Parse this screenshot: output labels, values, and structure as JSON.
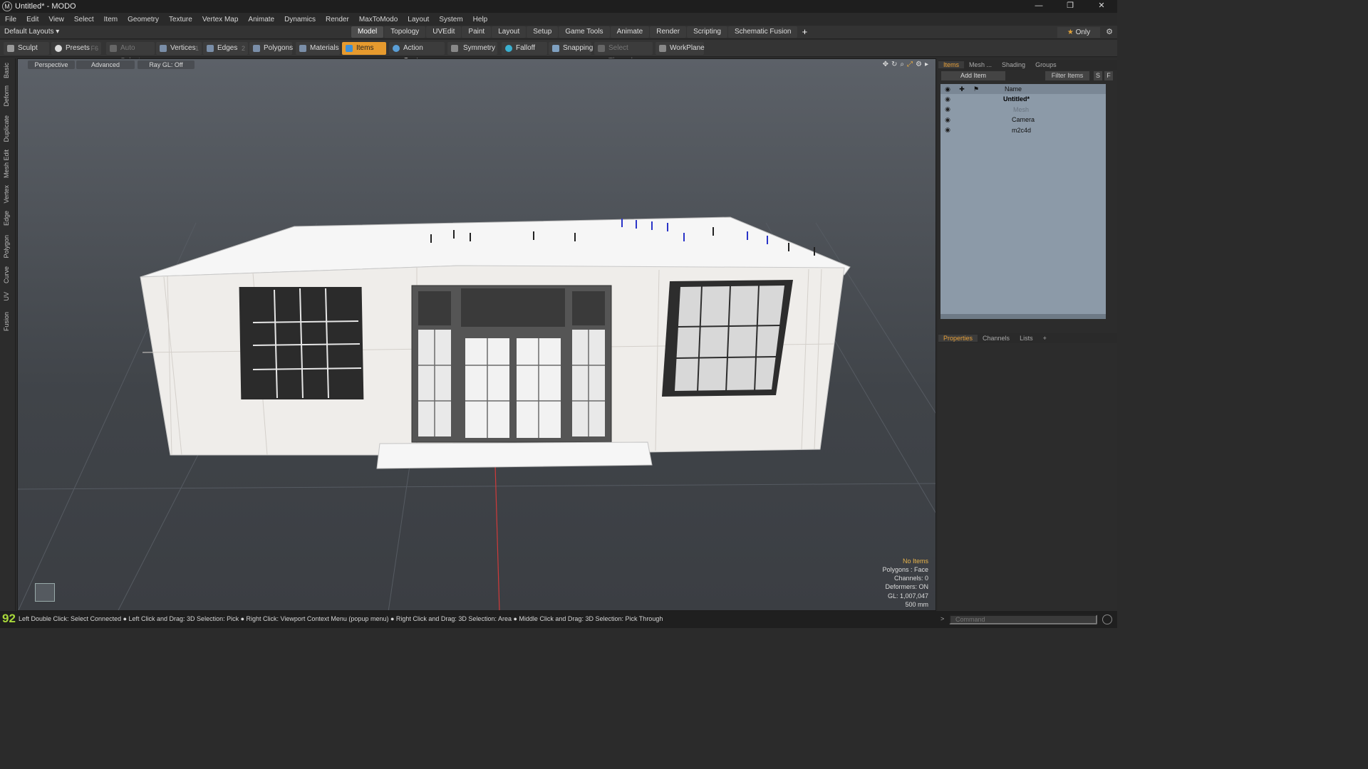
{
  "window": {
    "title": "Untitled* - MODO",
    "logo": "M",
    "controls": [
      "—",
      "❐",
      "✕"
    ]
  },
  "menu": [
    "File",
    "Edit",
    "View",
    "Select",
    "Item",
    "Geometry",
    "Texture",
    "Vertex Map",
    "Animate",
    "Dynamics",
    "Render",
    "MaxToModo",
    "Layout",
    "System",
    "Help"
  ],
  "layout": {
    "default_layouts": "Default Layouts ▾",
    "tabs": [
      "Model",
      "Topology",
      "UVEdit",
      "Paint",
      "Layout",
      "Setup",
      "Game Tools",
      "Animate",
      "Render",
      "Scripting",
      "Schematic Fusion"
    ],
    "active_tab": "Model",
    "add": "+",
    "only": "Only",
    "star": "★"
  },
  "toolbar": {
    "sculpt": "Sculpt",
    "presets": "Presets",
    "presets_key": "F6",
    "auto_select": "Auto Select",
    "vertices": "Vertices",
    "vertices_key": "1",
    "edges": "Edges",
    "edges_key": "2",
    "polygons": "Polygons",
    "materials": "Materials",
    "items": "Items",
    "action_center": "Action Center",
    "symmetry": "Symmetry",
    "falloff": "Falloff",
    "snapping": "Snapping",
    "select_through": "Select Through",
    "workplane": "WorkPlane"
  },
  "left_tabs": [
    "Basic",
    "Deform",
    "Duplicate",
    "Mesh Edit",
    "Vertex",
    "Edge",
    "Polygon",
    "Curve",
    "UV",
    "Fusion"
  ],
  "viewport": {
    "perspective": "Perspective",
    "advanced": "Advanced",
    "raygl": "Ray GL: Off",
    "icons": [
      "✥",
      "↻",
      "⌕",
      "⤢",
      "⚙",
      "▸"
    ],
    "stats": {
      "items": "No Items",
      "polygons": "Polygons : Face",
      "channels": "Channels: 0",
      "deformers": "Deformers: ON",
      "gl": "GL: 1,007,047",
      "scale": "500 mm"
    }
  },
  "items_panel": {
    "tabs": [
      "Items",
      "Mesh ...",
      "Shading",
      "Groups"
    ],
    "add_item": "Add Item",
    "filter": "Filter Items",
    "s": "S",
    "f": "F",
    "name_header": "Name",
    "rows": [
      {
        "name": "Untitled*"
      },
      {
        "name": "Mesh"
      },
      {
        "name": "Camera"
      },
      {
        "name": "m2c4d"
      }
    ]
  },
  "props_panel": {
    "tabs": [
      "Properties",
      "Channels",
      "Lists",
      "+"
    ]
  },
  "status": {
    "num": "92",
    "message": "Left Double Click: Select Connected ● Left Click and Drag: 3D Selection: Pick ● Right Click: Viewport Context Menu (popup menu) ● Right Click and Drag: 3D Selection: Area ● Middle Click and Drag: 3D Selection: Pick Through",
    "command_placeholder": "Command"
  },
  "colors": {
    "accent": "#e69a2e",
    "status_num": "#a8d83a",
    "tree_bg": "#8c9aa8"
  }
}
